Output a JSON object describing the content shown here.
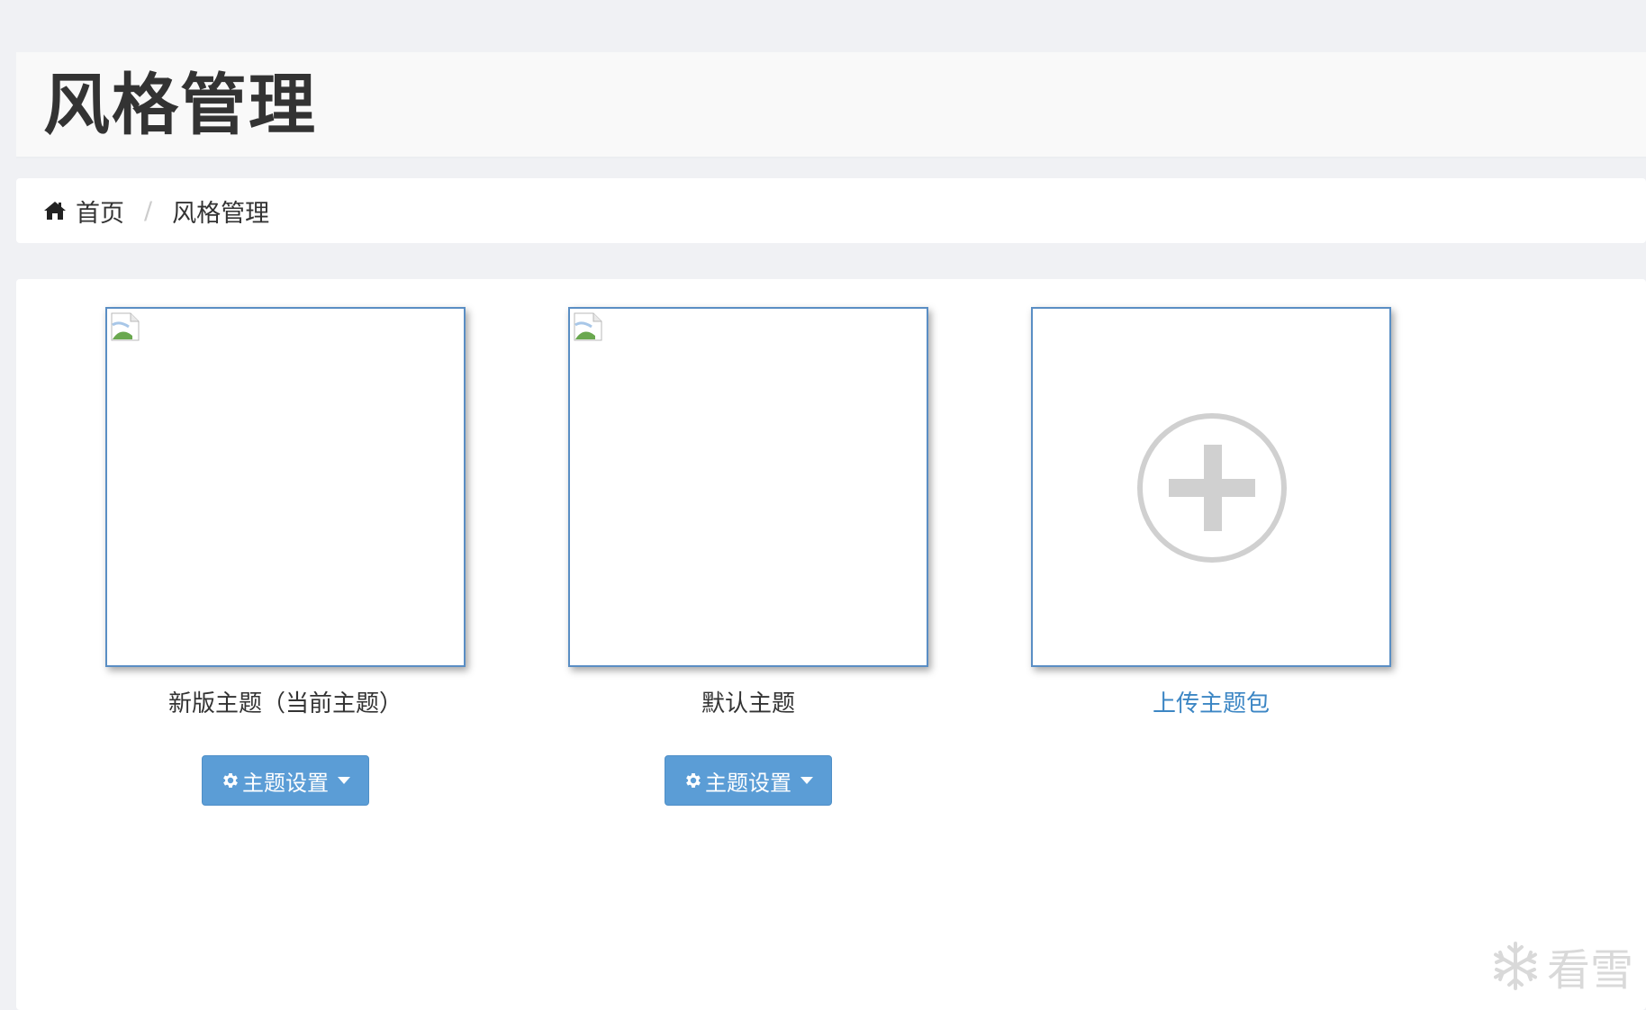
{
  "page": {
    "title": "风格管理"
  },
  "breadcrumb": {
    "home_label": "首页",
    "separator": "/",
    "current_label": "风格管理"
  },
  "themes": [
    {
      "name": "新版主题（当前主题）",
      "button_label": "主题设置",
      "icon": "broken-image-icon"
    },
    {
      "name": "默认主题",
      "button_label": "主题设置",
      "icon": "broken-image-icon"
    }
  ],
  "upload": {
    "label": "上传主题包",
    "icon": "plus-circle-icon"
  },
  "watermark": {
    "text": "看雪",
    "icon": "snowflake-icon"
  },
  "colors": {
    "accent": "#5b9dd6",
    "link": "#3c86c4",
    "thumb_border": "#5a8ec4",
    "page_bg": "#f0f1f4"
  }
}
